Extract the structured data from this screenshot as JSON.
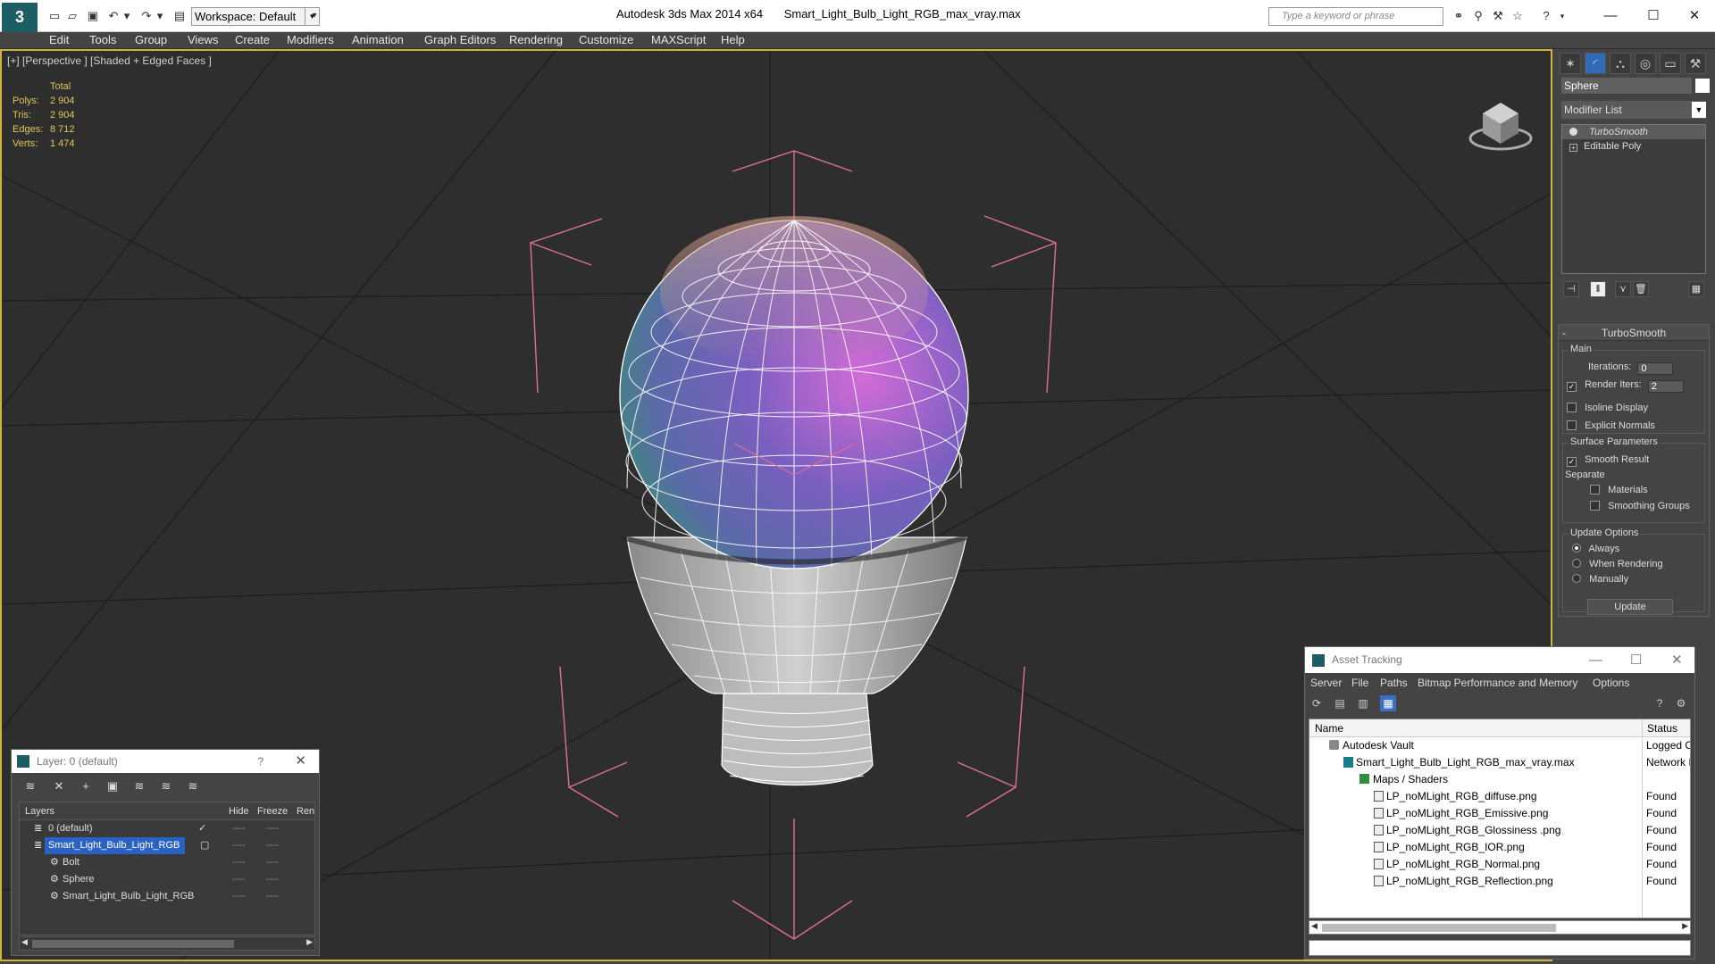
{
  "app": {
    "logo": "3",
    "workspace": "Workspace: Default",
    "title_app": "Autodesk 3ds Max  2014 x64",
    "title_file": "Smart_Light_Bulb_Light_RGB_max_vray.max",
    "search_placeholder": "Type a keyword or phrase"
  },
  "menu": [
    "Edit",
    "Tools",
    "Group",
    "Views",
    "Create",
    "Modifiers",
    "Animation",
    "Graph Editors",
    "Rendering",
    "Customize",
    "MAXScript",
    "Help"
  ],
  "viewport": {
    "label": "[+] [Perspective ] [Shaded + Edged Faces ]",
    "stats_header": "Total",
    "stats": [
      {
        "key": "Polys:",
        "value": "2 904"
      },
      {
        "key": "Tris:",
        "value": "2 904"
      },
      {
        "key": "Edges:",
        "value": "8 712"
      },
      {
        "key": "Verts:",
        "value": "1 474"
      }
    ]
  },
  "command_panel": {
    "object_name": "Sphere",
    "modifier_list": "Modifier List",
    "stack": [
      "TurboSmooth",
      "Editable Poly"
    ],
    "rollout_title": "TurboSmooth",
    "main_label": "Main",
    "iterations_label": "Iterations:",
    "iterations_value": "0",
    "render_iters_label": "Render Iters:",
    "render_iters_value": "2",
    "isoline_label": "Isoline Display",
    "explicit_normals_label": "Explicit Normals",
    "surface_label": "Surface Parameters",
    "smooth_result_label": "Smooth Result",
    "separate_label": "Separate",
    "materials_label": "Materials",
    "smoothing_groups_label": "Smoothing Groups",
    "update_options_label": "Update Options",
    "always_label": "Always",
    "when_rendering_label": "When Rendering",
    "manually_label": "Manually",
    "update_button": "Update"
  },
  "layer_dialog": {
    "title": "Layer: 0 (default)",
    "help": "?",
    "columns": {
      "layers": "Layers",
      "hide": "Hide",
      "freeze": "Freeze",
      "render": "Ren"
    },
    "rows": [
      {
        "name": "0 (default)",
        "dash": "----"
      },
      {
        "name": "Smart_Light_Bulb_Light_RGB",
        "dash": "----"
      },
      {
        "name": "Bolt",
        "dash": "----"
      },
      {
        "name": "Sphere",
        "dash": "----"
      },
      {
        "name": "Smart_Light_Bulb_Light_RGB",
        "dash": "----"
      }
    ]
  },
  "asset_tracking": {
    "title": "Asset Tracking",
    "menu": [
      "Server",
      "File",
      "Paths",
      "Bitmap Performance and Memory",
      "Options"
    ],
    "columns": {
      "name": "Name",
      "status": "Status"
    },
    "rows": [
      {
        "name": "Autodesk Vault",
        "status": "Logged O"
      },
      {
        "name": "Smart_Light_Bulb_Light_RGB_max_vray.max",
        "status": "Network I"
      },
      {
        "name": "Maps / Shaders",
        "status": ""
      },
      {
        "name": "LP_noMLight_RGB_diffuse.png",
        "status": "Found"
      },
      {
        "name": "LP_noMLight_RGB_Emissive.png",
        "status": "Found"
      },
      {
        "name": "LP_noMLight_RGB_Glossiness .png",
        "status": "Found"
      },
      {
        "name": "LP_noMLight_RGB_IOR.png",
        "status": "Found"
      },
      {
        "name": "LP_noMLight_RGB_Normal.png",
        "status": "Found"
      },
      {
        "name": "LP_noMLight_RGB_Reflection.png",
        "status": "Found"
      }
    ]
  },
  "colors": {
    "viewport_border": "#d2b33a",
    "selection": "#2a62c4",
    "stats": "#e0c65a",
    "gizmo": "#e06e9a"
  }
}
